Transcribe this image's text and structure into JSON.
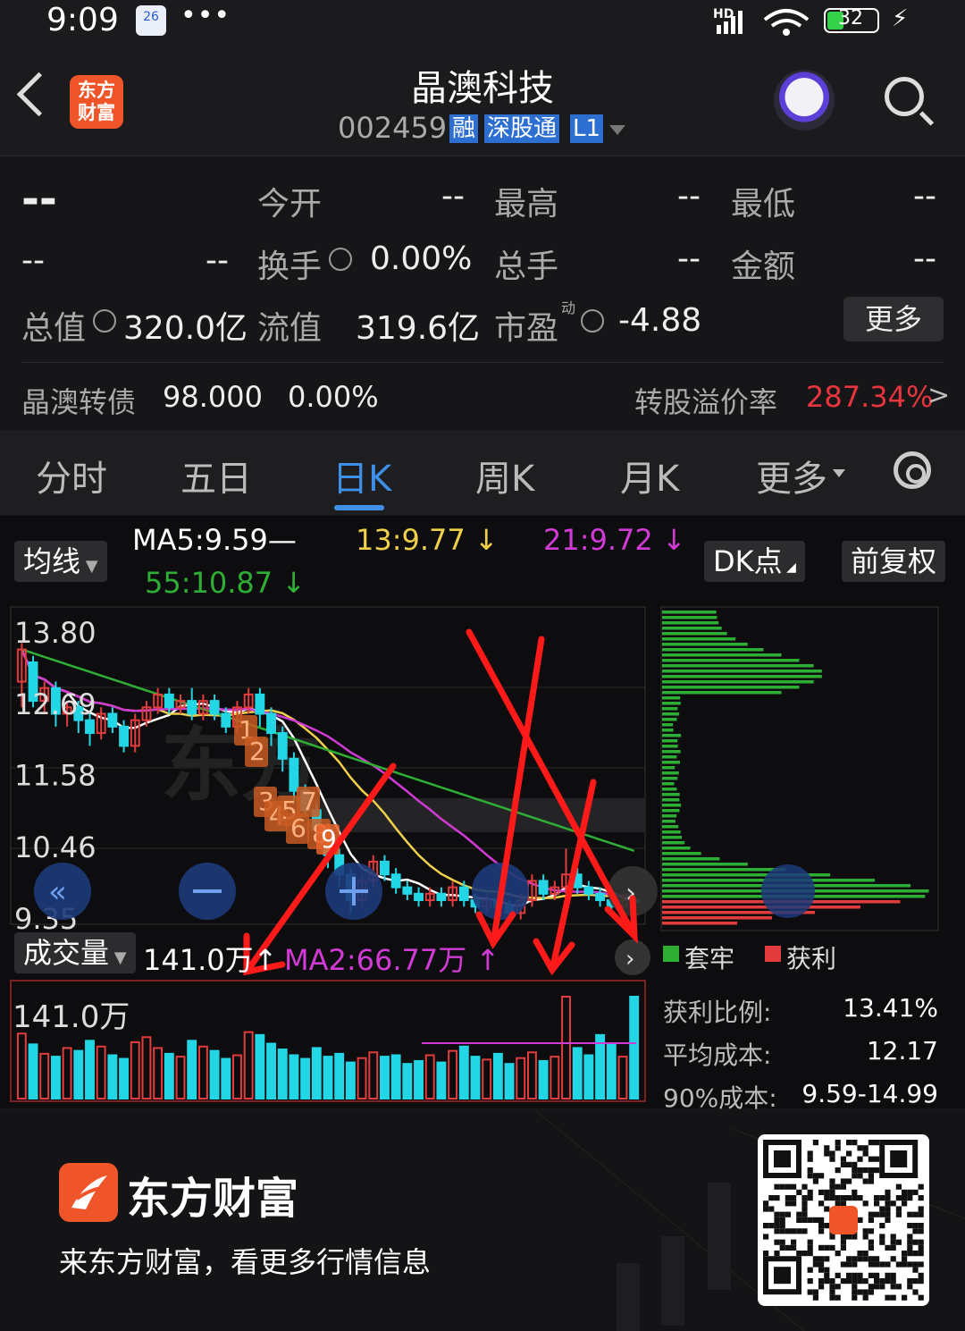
{
  "status": {
    "time": "9:09",
    "calendar_day": "26",
    "battery": "32",
    "network": "HD"
  },
  "header": {
    "logo_text_1": "东方",
    "logo_text_2": "财富",
    "stock_name": "晶澳科技",
    "stock_code": "002459",
    "tags": [
      "融",
      "深股通",
      "L1"
    ]
  },
  "quote": {
    "price": "--",
    "change_1": "--",
    "change_2": "--",
    "open_label": "今开",
    "open": "--",
    "high_label": "最高",
    "high": "--",
    "low_label": "最低",
    "low": "--",
    "turnover_label": "换手",
    "turnover": "0.00%",
    "volume_label": "总手",
    "volume": "--",
    "amount_label": "金额",
    "amount": "--",
    "mktcap_label": "总值",
    "mktcap": "320.0亿",
    "float_label": "流值",
    "float": "319.6亿",
    "pe_label": "市盈",
    "pe_sup": "动",
    "pe": "-4.88",
    "more_label": "更多",
    "bond_name": "晶澳转债",
    "bond_price": "98.000",
    "bond_change": "0.00%",
    "premium_label": "转股溢价率",
    "premium": "287.34%"
  },
  "tabs": [
    {
      "label": "分时"
    },
    {
      "label": "五日"
    },
    {
      "label": "日K"
    },
    {
      "label": "周K"
    },
    {
      "label": "月K"
    },
    {
      "label": "更多"
    }
  ],
  "chart": {
    "ma_btn": "均线",
    "ma5": "MA5:9.59",
    "ma13": "13:9.77",
    "ma21": "21:9.72",
    "ma55": "55:10.87",
    "dk_btn": "DK点",
    "fq_btn": "前复权",
    "vol_btn": "成交量",
    "vol_value": "141.0万",
    "vol_ma2": "MA2:66.77万",
    "vol_max_label": "141.0万",
    "dk_points": [
      "1",
      "2",
      "3",
      "4",
      "5",
      "6",
      "7",
      "8",
      "9"
    ],
    "legend_trapped": "套牢",
    "legend_profit": "获利",
    "profit_ratio_label": "获利比例:",
    "profit_ratio": "13.41%",
    "avg_cost_label": "平均成本:",
    "avg_cost": "12.17",
    "cost90_label": "90%成本:",
    "cost90": "9.59-14.99",
    "colors": {
      "ma5": "#ffffff",
      "ma13": "#f0d04a",
      "ma21": "#d23ad6",
      "ma55": "#2fae35",
      "up": "#e23c3c",
      "down": "#22d6e6",
      "annotation": "#ff1a1a"
    }
  },
  "chart_data": {
    "type": "candlestick",
    "y_ticks": [
      "13.80",
      "12.69",
      "11.58",
      "10.46",
      "9.35"
    ],
    "ylim": [
      9.35,
      13.8
    ],
    "candles": [
      [
        13.0,
        13.5,
        12.6,
        13.6
      ],
      [
        13.3,
        12.7,
        12.6,
        13.4
      ],
      [
        12.7,
        12.9,
        12.5,
        13.0
      ],
      [
        12.9,
        12.5,
        12.3,
        13.0
      ],
      [
        12.5,
        12.6,
        12.3,
        12.7
      ],
      [
        12.6,
        12.4,
        12.2,
        12.7
      ],
      [
        12.4,
        12.2,
        12.0,
        12.5
      ],
      [
        12.2,
        12.5,
        12.1,
        12.6
      ],
      [
        12.5,
        12.3,
        12.2,
        12.6
      ],
      [
        12.3,
        12.0,
        11.9,
        12.4
      ],
      [
        12.0,
        12.4,
        11.9,
        12.5
      ],
      [
        12.4,
        12.6,
        12.3,
        12.7
      ],
      [
        12.6,
        12.8,
        12.5,
        12.9
      ],
      [
        12.8,
        12.6,
        12.5,
        12.9
      ],
      [
        12.6,
        12.7,
        12.5,
        12.8
      ],
      [
        12.7,
        12.5,
        12.4,
        12.9
      ],
      [
        12.5,
        12.7,
        12.4,
        12.8
      ],
      [
        12.7,
        12.5,
        12.4,
        12.8
      ],
      [
        12.5,
        12.3,
        12.2,
        12.6
      ],
      [
        12.3,
        12.6,
        12.2,
        12.7
      ],
      [
        12.6,
        12.8,
        12.5,
        12.9
      ],
      [
        12.8,
        12.5,
        12.3,
        12.9
      ],
      [
        12.5,
        12.2,
        12.0,
        12.6
      ],
      [
        12.2,
        11.8,
        11.6,
        12.3
      ],
      [
        11.8,
        11.3,
        11.1,
        11.9
      ],
      [
        11.3,
        11.0,
        10.9,
        11.4
      ],
      [
        11.0,
        10.7,
        10.5,
        11.1
      ],
      [
        10.7,
        10.3,
        10.1,
        10.8
      ],
      [
        10.3,
        10.0,
        9.8,
        10.4
      ],
      [
        10.0,
        9.6,
        9.4,
        10.1
      ],
      [
        9.6,
        9.9,
        9.5,
        10.0
      ],
      [
        9.9,
        10.2,
        9.8,
        10.3
      ],
      [
        10.2,
        10.0,
        9.9,
        10.3
      ],
      [
        10.0,
        9.8,
        9.7,
        10.1
      ],
      [
        9.8,
        9.7,
        9.6,
        9.9
      ],
      [
        9.7,
        9.6,
        9.5,
        9.8
      ],
      [
        9.6,
        9.7,
        9.5,
        9.8
      ],
      [
        9.7,
        9.6,
        9.5,
        9.8
      ],
      [
        9.6,
        9.8,
        9.5,
        9.9
      ],
      [
        9.8,
        9.6,
        9.5,
        9.9
      ],
      [
        9.6,
        9.5,
        9.4,
        9.7
      ],
      [
        9.5,
        9.6,
        9.4,
        9.7
      ],
      [
        9.6,
        9.5,
        9.4,
        9.7
      ],
      [
        9.5,
        9.4,
        9.3,
        9.6
      ],
      [
        9.4,
        9.6,
        9.3,
        9.7
      ],
      [
        9.6,
        9.9,
        9.5,
        10.0
      ],
      [
        9.9,
        9.7,
        9.6,
        10.0
      ],
      [
        9.7,
        9.8,
        9.6,
        9.9
      ],
      [
        9.8,
        10.0,
        9.7,
        10.4
      ],
      [
        10.0,
        9.8,
        9.7,
        10.1
      ],
      [
        9.8,
        9.7,
        9.6,
        9.9
      ],
      [
        9.7,
        9.6,
        9.5,
        9.8
      ],
      [
        9.6,
        9.5,
        9.4,
        9.7
      ],
      [
        9.5,
        9.6,
        9.4,
        9.7
      ],
      [
        9.6,
        9.59,
        9.5,
        9.7
      ]
    ],
    "volumes": [
      90,
      75,
      62,
      58,
      70,
      66,
      80,
      72,
      60,
      55,
      78,
      85,
      70,
      62,
      58,
      80,
      72,
      66,
      55,
      60,
      92,
      88,
      76,
      68,
      60,
      55,
      70,
      58,
      62,
      50,
      56,
      64,
      58,
      60,
      48,
      52,
      60,
      50,
      66,
      72,
      58,
      54,
      62,
      48,
      56,
      64,
      52,
      58,
      141,
      70,
      60,
      88,
      76,
      58,
      141
    ],
    "ma_series": [
      "MA5",
      "13",
      "21",
      "55"
    ]
  }
}
